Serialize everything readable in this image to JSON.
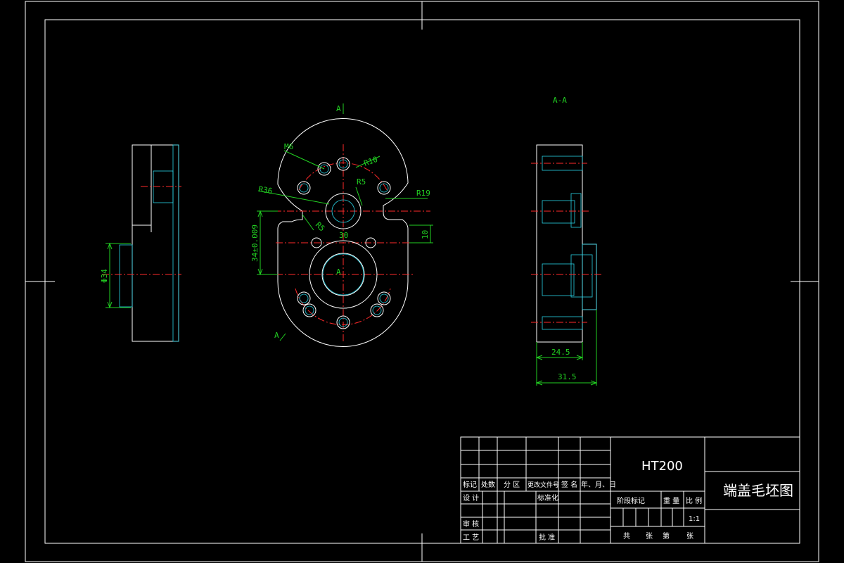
{
  "views": {
    "section_mark_top": "A",
    "section_mark_bottom": "A",
    "section_title": "A-A",
    "center_mark": "A"
  },
  "dimensions": {
    "phi34": "Φ34",
    "m6": "M6",
    "r36": "R36",
    "r10": "R10",
    "r5a": "R5",
    "r5b": "R5",
    "r19": "R19",
    "d30": "30",
    "d10": "10",
    "tol": "34±0.009",
    "d245": "24.5",
    "d315": "31.5"
  },
  "title_block": {
    "material": "HT200",
    "drawing_name": "端盖毛坯图",
    "row_labels": [
      "标记",
      "处数",
      "分 区",
      "更改文件号",
      "签 名",
      "年、月、日"
    ],
    "design": "设 计",
    "standardize": "标准化",
    "review": "审 核",
    "process": "工 艺",
    "approve": "批 准",
    "stage_mark": "阶段标记",
    "weight": "重 量",
    "scale_label": "比 例",
    "scale_value": "1:1",
    "total": "共",
    "sheet1": "张",
    "sheet_no": "第",
    "sheet2": "张"
  },
  "colors": {
    "outline": "#ffffff",
    "centerline": "#ff2a2a",
    "dimension": "#22d022",
    "hatch": "#2ad4e6",
    "background": "#000000"
  }
}
